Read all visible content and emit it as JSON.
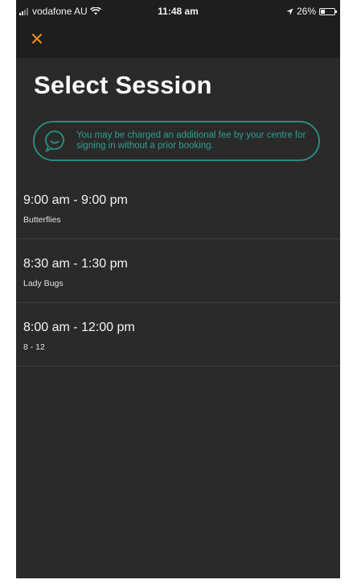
{
  "status_bar": {
    "carrier": "vodafone AU",
    "time": "11:48 am",
    "battery": "26%",
    "battery_level": 0.26,
    "icons": [
      "signal-icon",
      "wifi-icon",
      "location-arrow-icon",
      "battery-icon"
    ]
  },
  "nav": {
    "close_icon": "close-icon",
    "accent_color": "#e88a1a"
  },
  "page": {
    "title": "Select Session"
  },
  "notice": {
    "icon": "chat-bubble-icon",
    "text": "You may be charged an additional fee by your centre for signing in without a prior booking.",
    "color": "#2a8a7e"
  },
  "sessions": [
    {
      "time": "9:00 am - 9:00 pm",
      "name": "Butterflies"
    },
    {
      "time": "8:30 am - 1:30 pm",
      "name": "Lady Bugs"
    },
    {
      "time": "8:00 am - 12:00 pm",
      "name": "8 - 12"
    }
  ]
}
